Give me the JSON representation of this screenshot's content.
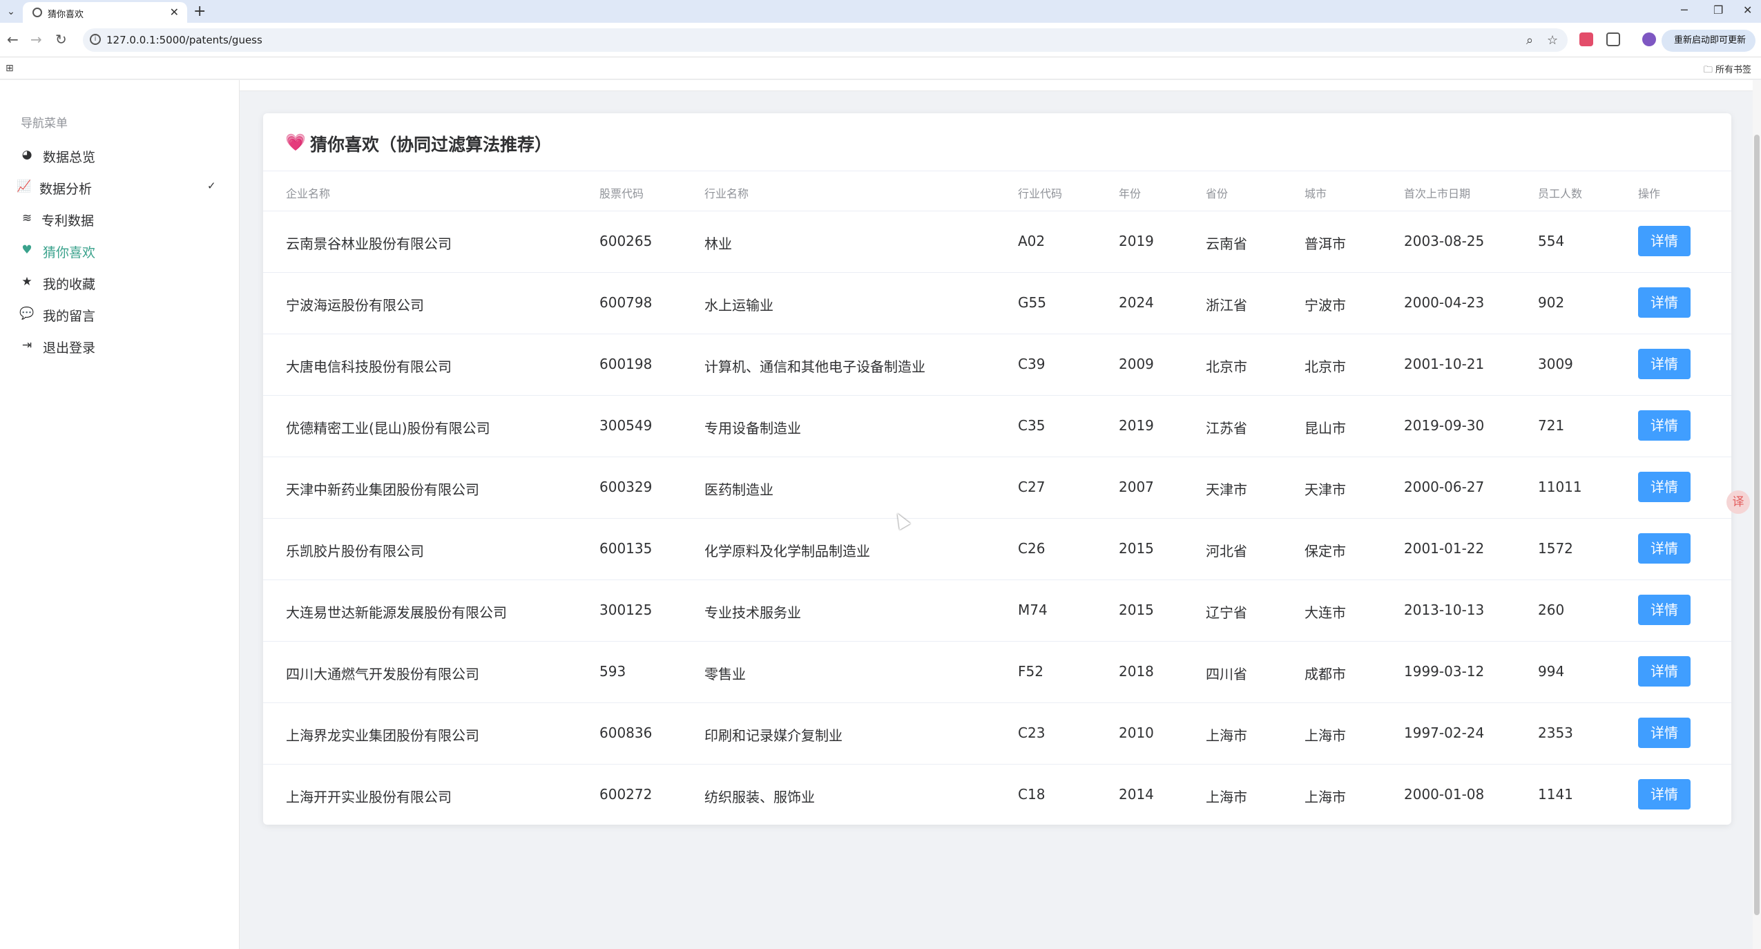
{
  "browser": {
    "tab_title": "猜你喜欢",
    "tab_close": "✕",
    "new_tab": "+",
    "url": "127.0.0.1:5000/patents/guess",
    "update_button": "重新启动即可更新 ⋮",
    "bookmarks_all": "所有书签",
    "window_controls": [
      "─",
      "❐",
      "✕"
    ]
  },
  "sidebar": {
    "title": "导航菜单",
    "items": [
      {
        "label": "数据总览",
        "icon": "pie-chart-icon"
      },
      {
        "label": "数据分析",
        "icon": "line-chart-icon",
        "chevron": "✓"
      },
      {
        "label": "专利数据",
        "icon": "database-icon"
      },
      {
        "label": "猜你喜欢",
        "icon": "heart-icon"
      },
      {
        "label": "我的收藏",
        "icon": "star-icon"
      },
      {
        "label": "我的留言",
        "icon": "comments-icon"
      },
      {
        "label": "退出登录",
        "icon": "logout-icon"
      }
    ],
    "active": "猜你喜欢",
    "active_color": "#3aa28c"
  },
  "card": {
    "title": "猜你喜欢（协同过滤算法推荐）",
    "columns": [
      "企业名称",
      "股票代码",
      "行业名称",
      "行业代码",
      "年份",
      "省份",
      "城市",
      "首次上市日期",
      "员工人数",
      "操作"
    ],
    "action_label": "详情",
    "action_color": "#409eff",
    "rows": [
      [
        "云南景谷林业股份有限公司",
        "600265",
        "林业",
        "A02",
        "2019",
        "云南省",
        "普洱市",
        "2003-08-25",
        "554"
      ],
      [
        "宁波海运股份有限公司",
        "600798",
        "水上运输业",
        "G55",
        "2024",
        "浙江省",
        "宁波市",
        "2000-04-23",
        "902"
      ],
      [
        "大唐电信科技股份有限公司",
        "600198",
        "计算机、通信和其他电子设备制造业",
        "C39",
        "2009",
        "北京市",
        "北京市",
        "2001-10-21",
        "3009"
      ],
      [
        "优德精密工业(昆山)股份有限公司",
        "300549",
        "专用设备制造业",
        "C35",
        "2019",
        "江苏省",
        "昆山市",
        "2019-09-30",
        "721"
      ],
      [
        "天津中新药业集团股份有限公司",
        "600329",
        "医药制造业",
        "C27",
        "2007",
        "天津市",
        "天津市",
        "2000-06-27",
        "11011"
      ],
      [
        "乐凯胶片股份有限公司",
        "600135",
        "化学原料及化学制品制造业",
        "C26",
        "2015",
        "河北省",
        "保定市",
        "2001-01-22",
        "1572"
      ],
      [
        "大连易世达新能源发展股份有限公司",
        "300125",
        "专业技术服务业",
        "M74",
        "2015",
        "辽宁省",
        "大连市",
        "2013-10-13",
        "260"
      ],
      [
        "四川大通燃气开发股份有限公司",
        "593",
        "零售业",
        "F52",
        "2018",
        "四川省",
        "成都市",
        "1999-03-12",
        "994"
      ],
      [
        "上海界龙实业集团股份有限公司",
        "600836",
        "印刷和记录媒介复制业",
        "C23",
        "2010",
        "上海市",
        "上海市",
        "1997-02-24",
        "2353"
      ],
      [
        "上海开开实业股份有限公司",
        "600272",
        "纺织服装、服饰业",
        "C18",
        "2014",
        "上海市",
        "上海市",
        "2000-01-08",
        "1141"
      ]
    ]
  }
}
